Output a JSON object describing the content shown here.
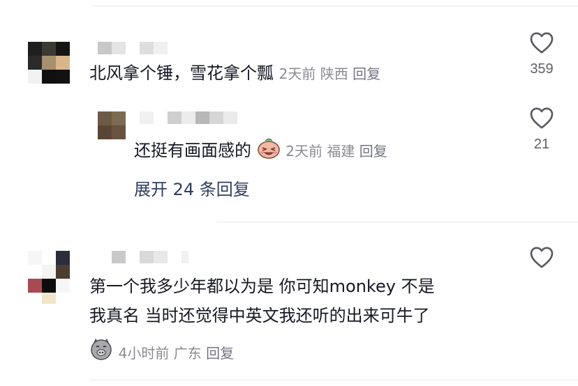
{
  "comments": [
    {
      "text": "北风拿个锤，雪花拿个瓢",
      "time": "2天前",
      "location": "陕西",
      "reply_label": "回复",
      "likes": "359",
      "reply": {
        "text": "还挺有画面感的",
        "emoji": "laughing-face-emoji",
        "time": "2天前",
        "location": "福建",
        "reply_label": "回复",
        "likes": "21"
      },
      "expand_label": "展开 24 条回复"
    },
    {
      "text_line1": "第一个我多少年都以为是 你可知monkey 不是",
      "text_line2": "我真名 当时还觉得中英文我还听的出来可牛了",
      "emoji": "pig-face-emoji",
      "time": "4小时前",
      "location": "广东",
      "reply_label": "回复"
    }
  ],
  "colors": {
    "text": "#161823",
    "meta": "#8a8b91",
    "link": "#2f3e5e"
  }
}
